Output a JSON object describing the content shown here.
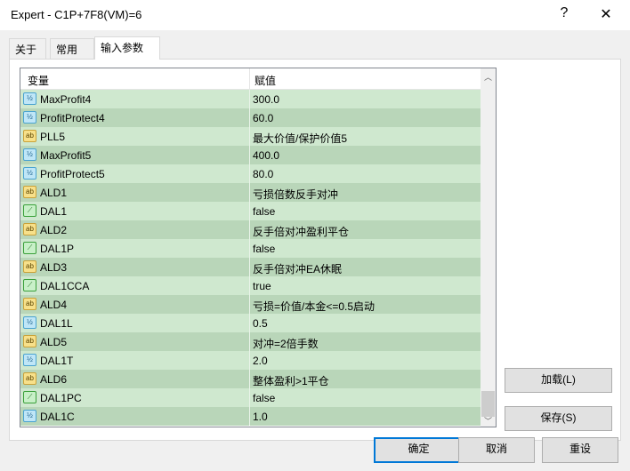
{
  "window": {
    "title": "Expert - C1P+7F8(VM)=6",
    "help": "?",
    "close": "✕"
  },
  "tabs": [
    "关于",
    "常用",
    "输入参数"
  ],
  "active_tab": 2,
  "table": {
    "headers": [
      "变量",
      "赋值"
    ],
    "rows": [
      {
        "type": "num",
        "name": "MaxProfit4",
        "value": "300.0"
      },
      {
        "type": "num",
        "name": "ProfitProtect4",
        "value": "60.0"
      },
      {
        "type": "str",
        "name": "PLL5",
        "value": "最大价值/保护价值5"
      },
      {
        "type": "num",
        "name": "MaxProfit5",
        "value": "400.0"
      },
      {
        "type": "num",
        "name": "ProfitProtect5",
        "value": "80.0"
      },
      {
        "type": "str",
        "name": "ALD1",
        "value": "亏损倍数反手对冲"
      },
      {
        "type": "bool",
        "name": "DAL1",
        "value": "false"
      },
      {
        "type": "str",
        "name": "ALD2",
        "value": "反手倍对冲盈利平仓"
      },
      {
        "type": "bool",
        "name": "DAL1P",
        "value": "false"
      },
      {
        "type": "str",
        "name": "ALD3",
        "value": "反手倍对冲EA休眠"
      },
      {
        "type": "bool",
        "name": "DAL1CCA",
        "value": "true"
      },
      {
        "type": "str",
        "name": "ALD4",
        "value": "亏损=价值/本金<=0.5启动"
      },
      {
        "type": "num",
        "name": "DAL1L",
        "value": "0.5"
      },
      {
        "type": "str",
        "name": "ALD5",
        "value": "对冲=2倍手数"
      },
      {
        "type": "num",
        "name": "DAL1T",
        "value": "2.0"
      },
      {
        "type": "str",
        "name": "ALD6",
        "value": "整体盈利>1平仓"
      },
      {
        "type": "bool",
        "name": "DAL1PC",
        "value": "false"
      },
      {
        "type": "num",
        "name": "DAL1C",
        "value": "1.0"
      }
    ]
  },
  "icons": {
    "num": "½",
    "str": "ab",
    "bool": "⟋"
  },
  "buttons": {
    "load": "加载(L)",
    "save": "保存(S)",
    "ok": "确定",
    "cancel": "取消",
    "reset": "重设"
  }
}
